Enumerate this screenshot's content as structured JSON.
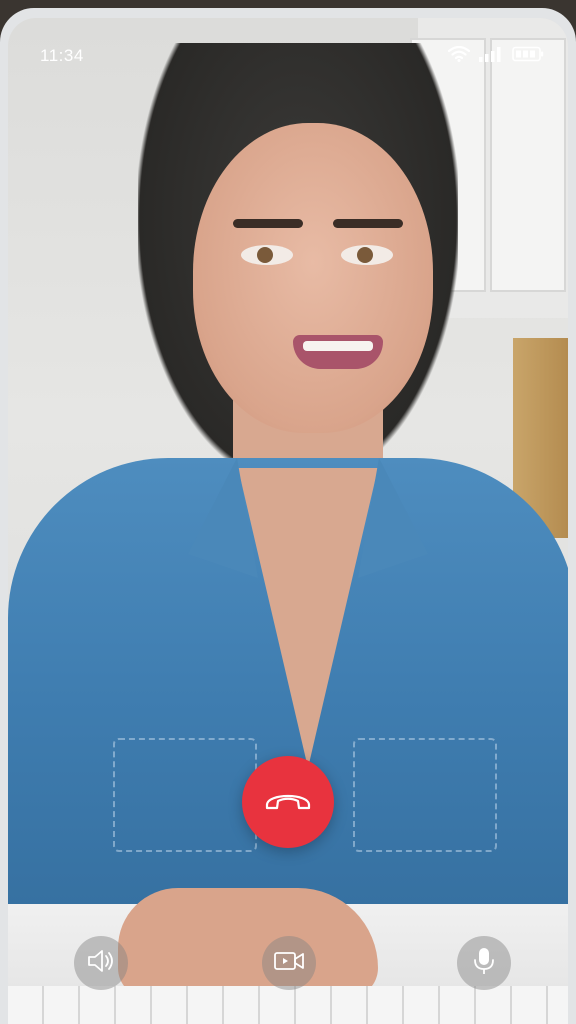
{
  "status_bar": {
    "time": "11:34",
    "icons": [
      "wifi-icon",
      "signal-icon",
      "battery-icon"
    ]
  },
  "call": {
    "end_call_icon": "phone-hangup-icon",
    "end_call_color": "#e8333e"
  },
  "controls": [
    {
      "name": "speaker-button",
      "icon": "speaker-icon"
    },
    {
      "name": "video-button",
      "icon": "video-camera-icon"
    },
    {
      "name": "microphone-button",
      "icon": "microphone-icon"
    }
  ]
}
